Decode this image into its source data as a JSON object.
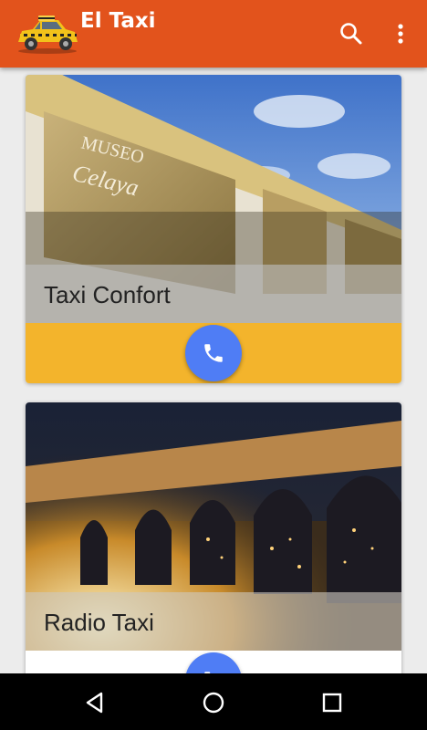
{
  "app": {
    "title": "El Taxi"
  },
  "toolbar": {
    "search_icon": "search-icon",
    "more_icon": "more-vert-icon"
  },
  "cards": [
    {
      "title": "Taxi Confort",
      "action_color": "#f3b42c",
      "call_icon": "phone-icon"
    },
    {
      "title": "Radio Taxi",
      "action_color": "#ffffff",
      "call_icon": "phone-icon"
    }
  ],
  "colors": {
    "appbar": "#e2531c",
    "fab": "#4f7df5",
    "accent_yellow": "#f3b42c"
  },
  "navbar": {
    "icons": [
      "back-icon",
      "home-icon",
      "recents-icon"
    ]
  }
}
